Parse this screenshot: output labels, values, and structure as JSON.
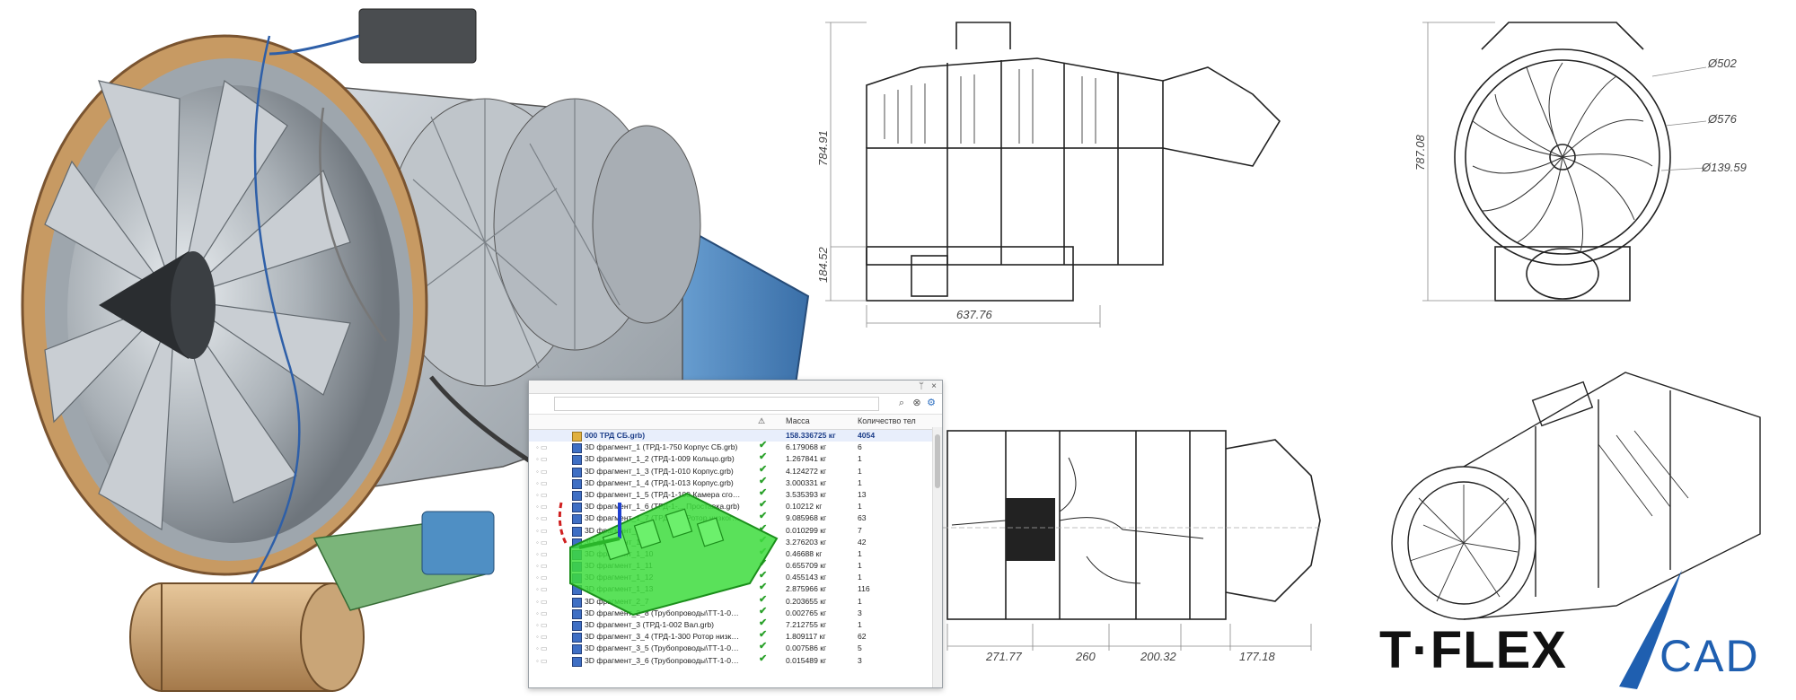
{
  "brand": {
    "logo_text": "T·FLEX",
    "logo_suffix": "CAD",
    "accent": "#1f5fb0"
  },
  "drawings": {
    "side_view": {
      "dim_height_total": "784.91",
      "dim_height_lower": "184.52",
      "dim_length": "637.76"
    },
    "front_view": {
      "dim_height": "787.08",
      "dia_1": "Ø502",
      "dia_2": "Ø576",
      "dia_3": "Ø139.59"
    },
    "bottom_view": {
      "dim_1": "271.77",
      "dim_2": "260",
      "dim_3": "200.32",
      "dim_4": "177.18"
    }
  },
  "model_tree": {
    "title_pin": "ᛘ",
    "title_close": "×",
    "columns": {
      "mass": "Масса",
      "count": "Количество тел"
    },
    "root": {
      "name": "000 ТРД СБ.grb)",
      "mass": "158.336725 кг",
      "count": "4054"
    },
    "rows": [
      {
        "name": "3D фрагмент_1 (ТРД-1-750 Корпус СБ.grb)",
        "mass": "6.179068 кг",
        "count": "6"
      },
      {
        "name": "3D фрагмент_1_2 (ТРД-1-009 Кольцо.grb)",
        "mass": "1.267841 кг",
        "count": "1"
      },
      {
        "name": "3D фрагмент_1_3 (ТРД-1-010 Корпус.grb)",
        "mass": "4.124272 кг",
        "count": "1"
      },
      {
        "name": "3D фрагмент_1_4 (ТРД-1-013 Корпус.grb)",
        "mass": "3.000331 кг",
        "count": "1"
      },
      {
        "name": "3D фрагмент_1_5 (ТРД-1-100 Камера сгорания ...",
        "mass": "3.535393 кг",
        "count": "13"
      },
      {
        "name": "3D фрагмент_1_6 (ТРД-1-... Проставка.grb)",
        "mass": "0.10212 кг",
        "count": "1"
      },
      {
        "name": "3D фрагмент_1_7 (ТРД-1-... Ротор низкого да...",
        "mass": "9.085968 кг",
        "count": "63"
      },
      {
        "name": "3D фрагмент_1_8",
        "mass": "0.010299 кг",
        "count": "7"
      },
      {
        "name": "3D фрагмент_1_9",
        "mass": "3.276203 кг",
        "count": "42"
      },
      {
        "name": "3D фрагмент_1_10",
        "mass": "0.46688 кг",
        "count": "1"
      },
      {
        "name": "3D фрагмент_1_11",
        "mass": "0.655709 кг",
        "count": "1"
      },
      {
        "name": "3D фрагмент_1_12",
        "mass": "0.455143 кг",
        "count": "1"
      },
      {
        "name": "3D фрагмент_1_13",
        "mass": "2.875966 кг",
        "count": "116"
      },
      {
        "name": "3D фрагмент_2_7",
        "mass": "0.203655 кг",
        "count": "1"
      },
      {
        "name": "3D фрагмент_2_8 (Трубопроводы\\ТТ-1-001 Тр...",
        "mass": "0.002765 кг",
        "count": "3"
      },
      {
        "name": "3D фрагмент_3 (ТРД-1-002 Вал.grb)",
        "mass": "7.212755 кг",
        "count": "1"
      },
      {
        "name": "3D фрагмент_3_4 (ТРД-1-300 Ротор низкого да...",
        "mass": "1.809117 кг",
        "count": "62"
      },
      {
        "name": "3D фрагмент_3_5 (Трубопроводы\\ТТ-1-014 Тр...",
        "mass": "0.007586 кг",
        "count": "5"
      },
      {
        "name": "3D фрагмент_3_6 (Трубопроводы\\ТТ-1-061 Тр...",
        "mass": "0.015489 кг",
        "count": "3"
      }
    ]
  }
}
